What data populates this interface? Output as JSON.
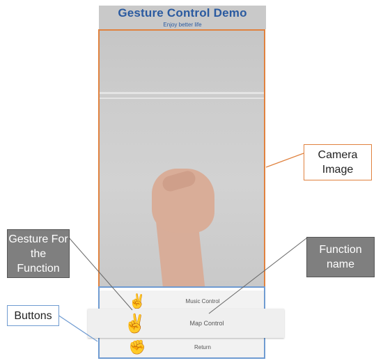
{
  "app": {
    "title": "Gesture Control Demo",
    "subtitle": "Enjoy better life"
  },
  "buttons": [
    {
      "label": "Music Control",
      "gesture_icon": "peace-sign-hand-icon"
    },
    {
      "label": "Map Control",
      "gesture_icon": "peace-sign-hand-icon"
    },
    {
      "label": "Return",
      "gesture_icon": "fist-hand-icon"
    }
  ],
  "callouts": {
    "camera": "Camera Image",
    "gesture": "Gesture For the Function",
    "function_name": "Function name",
    "buttons": "Buttons"
  },
  "colors": {
    "header_bg": "#c9c9c9",
    "title_text": "#2a5aa0",
    "camera_border": "#e0823f",
    "button_panel_border": "#6f9bd1",
    "callout_dark_bg": "#7f7f7f"
  }
}
